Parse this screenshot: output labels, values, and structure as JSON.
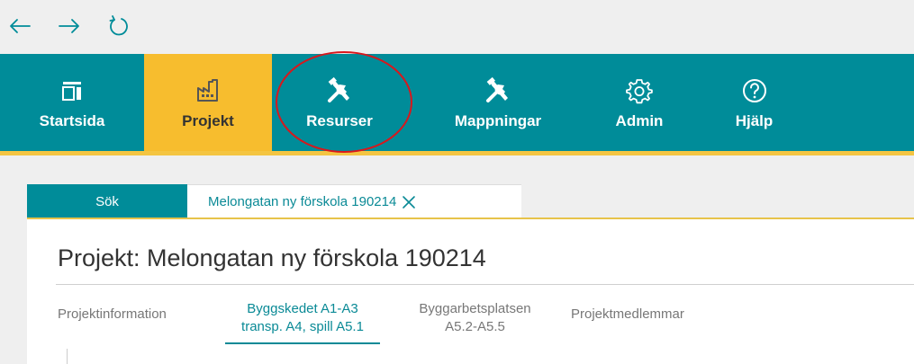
{
  "browser": {
    "back_icon": "arrow-left-icon",
    "forward_icon": "arrow-right-icon",
    "reload_icon": "reload-icon"
  },
  "ribbon": {
    "items": [
      {
        "label": "Startsida",
        "icon": "home-layout-icon"
      },
      {
        "label": "Projekt",
        "icon": "factory-icon",
        "active": true
      },
      {
        "label": "Resurser",
        "icon": "tools-icon",
        "highlighted": true
      },
      {
        "label": "Mappningar",
        "icon": "tools-icon"
      },
      {
        "label": "Admin",
        "icon": "gear-icon"
      },
      {
        "label": "Hjälp",
        "icon": "help-circle-icon"
      }
    ]
  },
  "tabs": {
    "search_label": "Sök",
    "project_label": "Melongatan ny förskola 190214",
    "close_icon": "close-icon"
  },
  "page": {
    "title": "Projekt: Melongatan ny förskola 190214"
  },
  "subtabs": [
    {
      "line1": "Projektinformation",
      "line2": ""
    },
    {
      "line1": "Byggskedet A1-A3",
      "line2": "transp. A4, spill A5.1",
      "active": true
    },
    {
      "line1": "Byggarbetsplatsen",
      "line2": "A5.2-A5.5"
    },
    {
      "line1": "Projektmedlemmar",
      "line2": ""
    }
  ],
  "colors": {
    "accent_teal": "#008c99",
    "active_yellow": "#f7bd2e",
    "highlight_red": "#d9171c"
  }
}
